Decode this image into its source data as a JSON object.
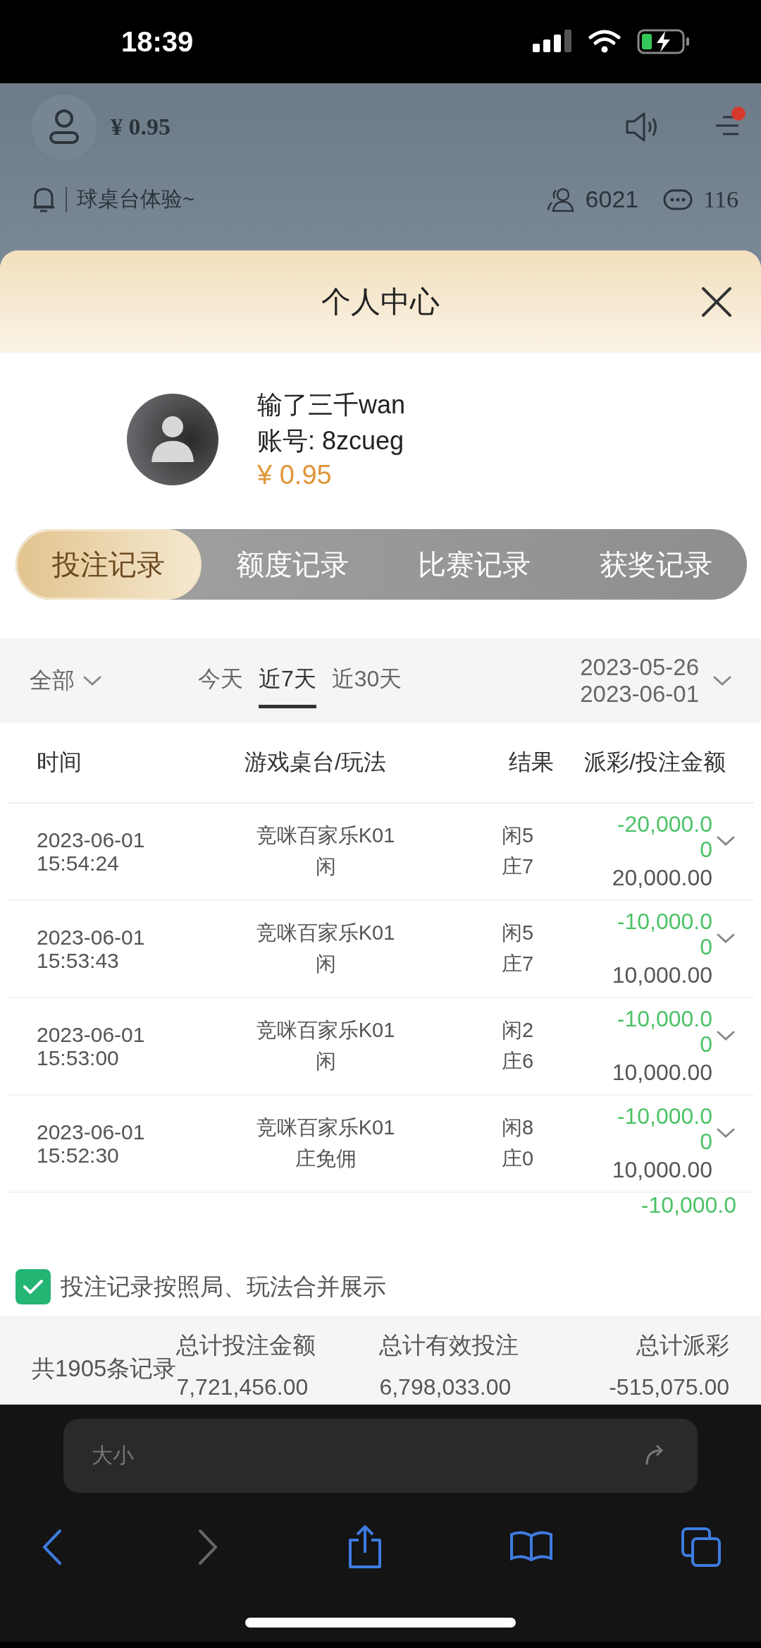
{
  "status_bar": {
    "time": "18:39"
  },
  "app_header": {
    "balance": "¥ 0.95",
    "notification_dot": true,
    "notice": "球桌台体验~",
    "online_count": "6021",
    "chat_count": "116"
  },
  "modal": {
    "title": "个人中心",
    "user": {
      "name": "输了三千wan",
      "account": "账号: 8zcueg",
      "balance": "¥ 0.95"
    },
    "tabs": [
      {
        "label": "投注记录",
        "selected": true
      },
      {
        "label": "额度记录",
        "selected": false
      },
      {
        "label": "比赛记录",
        "selected": false
      },
      {
        "label": "获奖记录",
        "selected": false
      }
    ],
    "filter": {
      "category": "全部",
      "ranges": [
        {
          "label": "今天",
          "selected": false
        },
        {
          "label": "近7天",
          "selected": true
        },
        {
          "label": "近30天",
          "selected": false
        }
      ],
      "date_from": "2023-05-26",
      "date_to": "2023-06-01"
    },
    "columns": [
      "时间",
      "游戏桌台/玩法",
      "结果",
      "派彩/投注金额"
    ],
    "rows": [
      {
        "date": "2023-06-01",
        "time": "15:54:24",
        "table": "竞咪百家乐K01",
        "bet": "闲",
        "result_1": "闲5",
        "result_2": "庄7",
        "payout": "-20,000.00",
        "stake": "20,000.00"
      },
      {
        "date": "2023-06-01",
        "time": "15:53:43",
        "table": "竞咪百家乐K01",
        "bet": "闲",
        "result_1": "闲5",
        "result_2": "庄7",
        "payout": "-10,000.00",
        "stake": "10,000.00"
      },
      {
        "date": "2023-06-01",
        "time": "15:53:00",
        "table": "竞咪百家乐K01",
        "bet": "闲",
        "result_1": "闲2",
        "result_2": "庄6",
        "payout": "-10,000.00",
        "stake": "10,000.00"
      },
      {
        "date": "2023-06-01",
        "time": "15:52:30",
        "table": "竞咪百家乐K01",
        "bet": "庄免佣",
        "result_1": "闲8",
        "result_2": "庄0",
        "payout": "-10,000.00",
        "stake": "10,000.00"
      },
      {
        "payout": "-10,000.0"
      }
    ],
    "merge_option": {
      "label": "投注记录按照局、玩法合并展示",
      "checked": true
    },
    "summary": {
      "count": "共1905条记录",
      "totals": [
        {
          "label": "总计投注金额",
          "value": "7,721,456.00"
        },
        {
          "label": "总计有效投注",
          "value": "6,798,033.00"
        },
        {
          "label": "总计派彩",
          "value": "-515,075.00"
        }
      ]
    }
  },
  "browser": {
    "address": "大小"
  }
}
